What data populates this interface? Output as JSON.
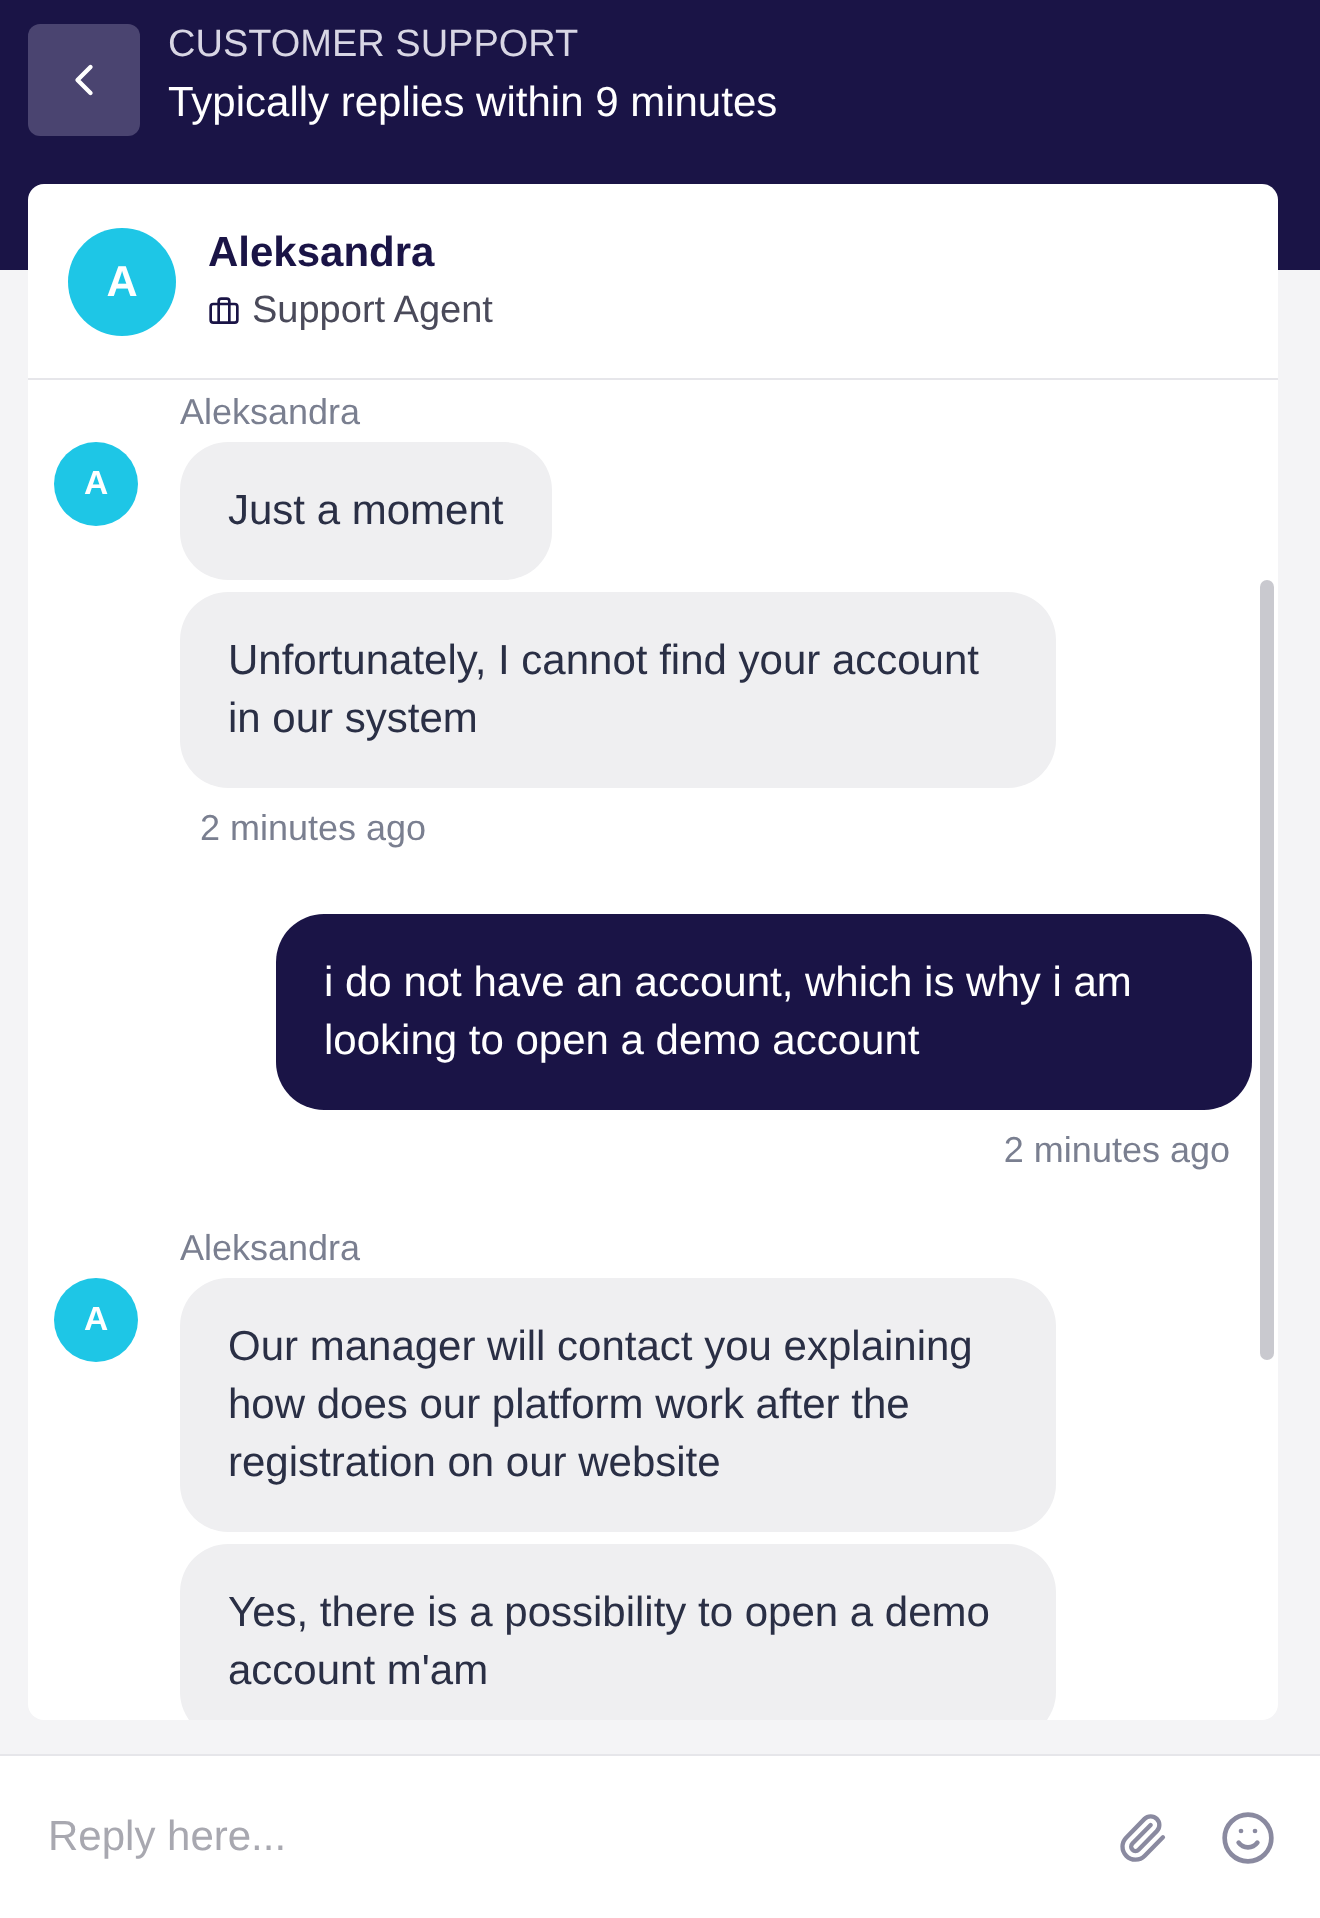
{
  "header": {
    "title": "CUSTOMER SUPPORT",
    "subtitle": "Typically replies within 9 minutes"
  },
  "agent": {
    "initial": "A",
    "name": "Aleksandra",
    "role": "Support Agent"
  },
  "messages": [
    {
      "kind": "agent",
      "sender": "Aleksandra",
      "initial": "A",
      "bubbles": [
        "Just a moment",
        "Unfortunately, I cannot find your account in our system"
      ],
      "time": "2 minutes ago"
    },
    {
      "kind": "user",
      "bubbles": [
        "i do not have an account, which is why i am looking to open a demo account"
      ],
      "time": "2 minutes ago"
    },
    {
      "kind": "agent",
      "sender": "Aleksandra",
      "initial": "A",
      "bubbles": [
        "Our manager will contact you explaining how does our platform work after the registration on our website",
        "Yes, there is a possibility to open a demo account m'am"
      ]
    }
  ],
  "composer": {
    "placeholder": "Reply here..."
  }
}
